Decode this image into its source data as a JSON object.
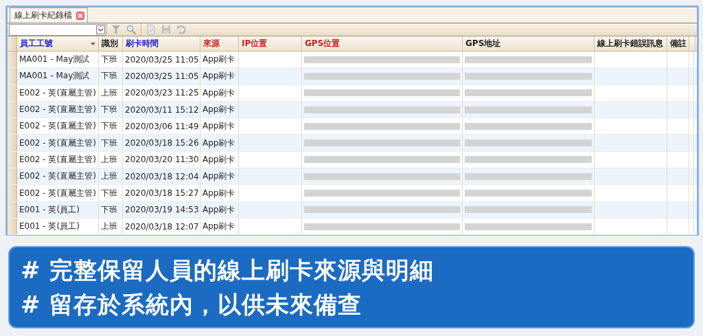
{
  "tab": {
    "label": "線上刷卡紀錄檔"
  },
  "table": {
    "columns": [
      {
        "label": "員工工號",
        "color": "#2222cc",
        "sorted": true
      },
      {
        "label": "識別",
        "color": "#222222",
        "sorted": false
      },
      {
        "label": "刷卡時間",
        "color": "#2222cc",
        "sorted": false
      },
      {
        "label": "來源",
        "color": "#cc2222",
        "sorted": false
      },
      {
        "label": "IP位置",
        "color": "#cc2222",
        "sorted": false
      },
      {
        "label": "GPS位置",
        "color": "#cc2222",
        "sorted": false
      },
      {
        "label": "GPS地址",
        "color": "#222222",
        "sorted": false
      },
      {
        "label": "線上刷卡錯誤訊息",
        "color": "#222222",
        "sorted": false
      },
      {
        "label": "備註",
        "color": "#222222",
        "sorted": false
      }
    ],
    "rows": [
      {
        "employee": "MA001 - May測試",
        "type": "下班",
        "time": "2020/03/25 11:05",
        "source": "App刷卡"
      },
      {
        "employee": "MA001 - May測試",
        "type": "下班",
        "time": "2020/03/25 11:05",
        "source": "App刷卡"
      },
      {
        "employee": "E002 - 英(直屬主管)",
        "type": "上班",
        "time": "2020/03/23 11:25",
        "source": "App刷卡"
      },
      {
        "employee": "E002 - 英(直屬主管)",
        "type": "下班",
        "time": "2020/03/11 15:12",
        "source": "App刷卡"
      },
      {
        "employee": "E002 - 英(直屬主管)",
        "type": "下班",
        "time": "2020/03/06 11:49",
        "source": "App刷卡"
      },
      {
        "employee": "E002 - 英(直屬主管)",
        "type": "下班",
        "time": "2020/03/18 15:26",
        "source": "App刷卡"
      },
      {
        "employee": "E002 - 英(直屬主管)",
        "type": "上班",
        "time": "2020/03/20 11:30",
        "source": "App刷卡"
      },
      {
        "employee": "E002 - 英(直屬主管)",
        "type": "上班",
        "time": "2020/03/18 12:04",
        "source": "App刷卡"
      },
      {
        "employee": "E002 - 英(直屬主管)",
        "type": "下班",
        "time": "2020/03/18 15:27",
        "source": "App刷卡"
      },
      {
        "employee": "E001 - 英(員工)",
        "type": "下班",
        "time": "2020/03/19 14:53",
        "source": "App刷卡"
      },
      {
        "employee": "E001 - 英(員工)",
        "type": "上班",
        "time": "2020/03/18 12:07",
        "source": "App刷卡"
      }
    ]
  },
  "caption": [
    "# 完整保留人員的線上刷卡來源與明細",
    "# 留存於系統內，以供未來備查"
  ]
}
